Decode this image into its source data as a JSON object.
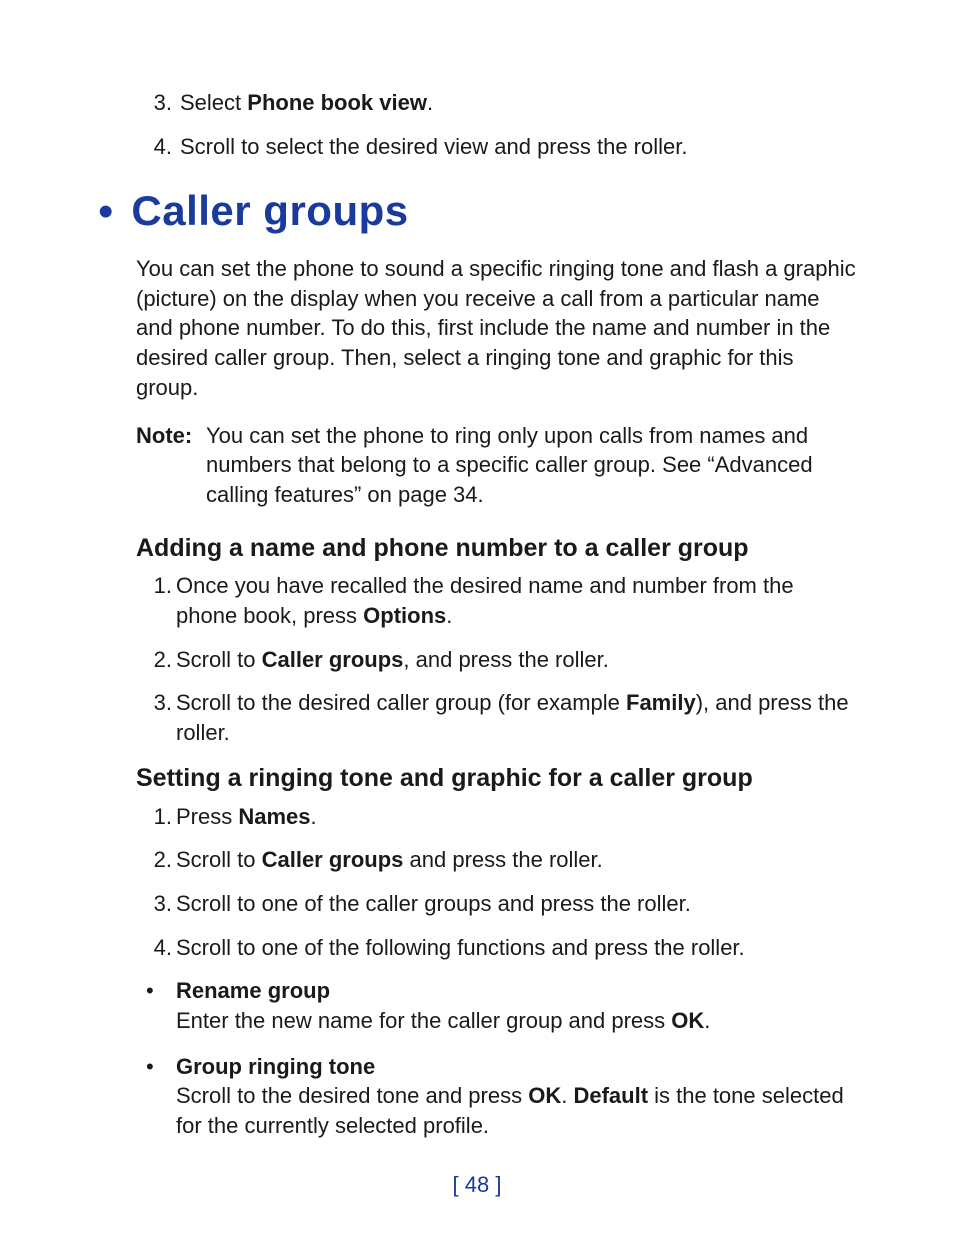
{
  "topList": {
    "item3": {
      "num": "3.",
      "pre": "Select ",
      "bold": "Phone book view",
      "post": "."
    },
    "item4": {
      "num": "4.",
      "text": "Scroll to select the desired view and press the roller."
    }
  },
  "h1": "Caller groups",
  "intro": "You can set the phone to sound a specific ringing tone and flash a graphic (picture) on the display when you receive a call from a particular name and phone number. To do this, first include the name and number in the desired caller group. Then, select a ringing tone and graphic for this group.",
  "note": {
    "label": "Note:",
    "body": "You can set the phone to ring only upon calls from names and numbers that belong to a specific caller group. See “Advanced calling features” on page 34."
  },
  "sectionA": {
    "title": "Adding a name and phone number to a caller group",
    "item1": {
      "num": "1.",
      "pre": "Once you have recalled the desired name and number from the phone book, press ",
      "bold": "Options",
      "post": "."
    },
    "item2": {
      "num": "2.",
      "pre": "Scroll to ",
      "bold": "Caller groups",
      "post": ", and press the roller."
    },
    "item3": {
      "num": "3.",
      "pre": "Scroll to the desired caller group (for example ",
      "bold": "Family",
      "post": "), and press the roller."
    }
  },
  "sectionB": {
    "title": "Setting a ringing tone and graphic for a caller group",
    "item1": {
      "num": "1.",
      "pre": "Press ",
      "bold": "Names",
      "post": "."
    },
    "item2": {
      "num": "2.",
      "pre": "Scroll to ",
      "bold": "Caller groups",
      "post": " and press the roller."
    },
    "item3": {
      "num": "3.",
      "text": "Scroll to one of the caller groups and press the roller."
    },
    "item4": {
      "num": "4.",
      "text": "Scroll to one of the following functions and press the roller."
    },
    "bullet1": {
      "title": "Rename group",
      "pre": "Enter the new name for the caller group and press ",
      "bold": "OK",
      "post": "."
    },
    "bullet2": {
      "title": "Group ringing tone",
      "pre": "Scroll to the desired tone and press ",
      "bold1": "OK",
      "mid": ". ",
      "bold2": "Default",
      "post": " is the tone selected for the currently selected profile."
    }
  },
  "footer": "[ 48 ]"
}
